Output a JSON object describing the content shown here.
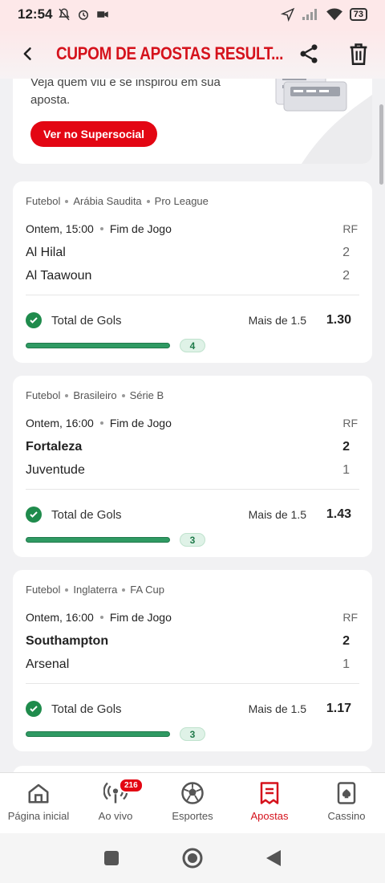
{
  "status_bar": {
    "time": "12:54",
    "battery": "73",
    "icons": [
      "mute-icon",
      "alarm-icon",
      "video-icon",
      "location-icon",
      "signal-icon",
      "wifi-icon",
      "battery-icon"
    ]
  },
  "header": {
    "title": "CUPOM DE APOSTAS RESULT...",
    "back_icon": "back-arrow-icon",
    "share_icon": "share-icon",
    "delete_icon": "trash-icon",
    "accent": "#d5121c"
  },
  "social_card": {
    "description": "Veja quem viu e se inspirou em sua aposta.",
    "button_label": "Ver no Supersocial"
  },
  "bets": [
    {
      "sport": "Futebol",
      "country": "Arábia Saudita",
      "league": "Pro League",
      "time": "Ontem, 15:00",
      "status": "Fim de Jogo",
      "period": "RF",
      "home_team": "Al Hilal",
      "home_score": "2",
      "away_team": "Al Taawoun",
      "away_score": "2",
      "winner": "none",
      "market": "Total de Gols",
      "selection": "Mais de 1.5",
      "odd": "1.30",
      "total_goals": "4"
    },
    {
      "sport": "Futebol",
      "country": "Brasileiro",
      "league": "Série B",
      "time": "Ontem, 16:00",
      "status": "Fim de Jogo",
      "period": "RF",
      "home_team": "Fortaleza",
      "home_score": "2",
      "away_team": "Juventude",
      "away_score": "1",
      "winner": "home",
      "market": "Total de Gols",
      "selection": "Mais de 1.5",
      "odd": "1.43",
      "total_goals": "3"
    },
    {
      "sport": "Futebol",
      "country": "Inglaterra",
      "league": "FA Cup",
      "time": "Ontem, 16:00",
      "status": "Fim de Jogo",
      "period": "RF",
      "home_team": "Southampton",
      "home_score": "2",
      "away_team": "Arsenal",
      "away_score": "1",
      "winner": "home",
      "market": "Total de Gols",
      "selection": "Mais de 1.5",
      "odd": "1.17",
      "total_goals": "3"
    }
  ],
  "bottom_nav": [
    {
      "label": "Página inicial",
      "icon": "home-icon",
      "active": false
    },
    {
      "label": "Ao vivo",
      "icon": "live-icon",
      "active": false,
      "badge": "216"
    },
    {
      "label": "Esportes",
      "icon": "soccer-ball-icon",
      "active": false
    },
    {
      "label": "Apostas",
      "icon": "bet-slip-icon",
      "active": true
    },
    {
      "label": "Cassino",
      "icon": "cards-icon",
      "active": false
    }
  ],
  "system_nav": [
    "recents-button",
    "home-button",
    "back-button"
  ],
  "colors": {
    "brand_red": "#e30613",
    "success_green": "#1f8b4c",
    "background": "#f1f1f3"
  }
}
